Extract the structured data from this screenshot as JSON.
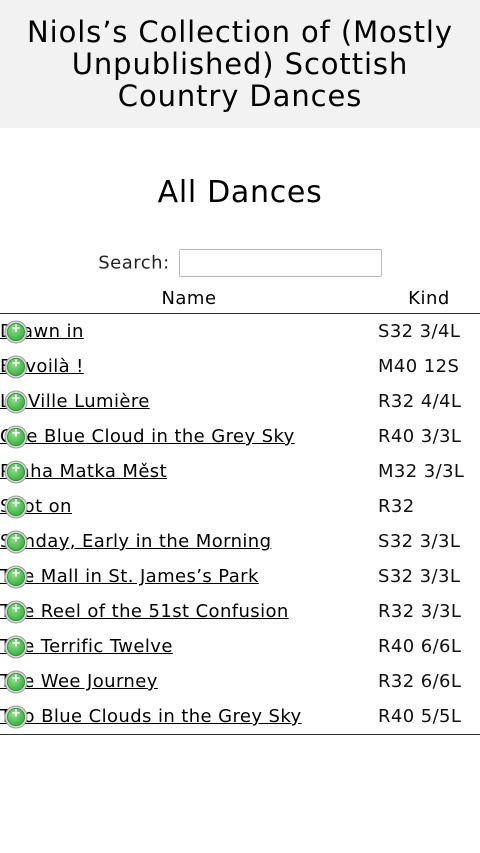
{
  "header": {
    "title": "Niols’s Collection of (Mostly Unpublished) Scottish Country Dances"
  },
  "page": {
    "heading": "All Dances"
  },
  "search": {
    "label": "Search:",
    "value": "",
    "placeholder": ""
  },
  "table": {
    "columns": [
      "Name",
      "Kind"
    ],
    "rows": [
      {
        "name": "Drawn in",
        "kind": "S32 3/4L"
      },
      {
        "name": "Et voilà !",
        "kind": "M40 12S"
      },
      {
        "name": "La Ville Lumière",
        "kind": "R32 4/4L"
      },
      {
        "name": "One Blue Cloud in the Grey Sky",
        "kind": "R40 3/3L"
      },
      {
        "name": "Praha Matka Měst",
        "kind": "M32 3/3L"
      },
      {
        "name": "Spot on",
        "kind": "R32"
      },
      {
        "name": "Sunday, Early in the Morning",
        "kind": "S32 3/3L"
      },
      {
        "name": "The Mall in St. James’s Park",
        "kind": "S32 3/3L"
      },
      {
        "name": "The Reel of the 51st Confusion",
        "kind": "R32 3/3L"
      },
      {
        "name": "The Terrific Twelve",
        "kind": "R40 6/6L"
      },
      {
        "name": "The Wee Journey",
        "kind": "R32 6/6L"
      },
      {
        "name": "Two Blue Clouds in the Grey Sky",
        "kind": "R40 5/5L"
      }
    ]
  },
  "icons": {
    "expand": "plus-circle-icon"
  },
  "colors": {
    "header_bg": "#f2f2f2",
    "expand_icon_fill": "#3cb043"
  }
}
